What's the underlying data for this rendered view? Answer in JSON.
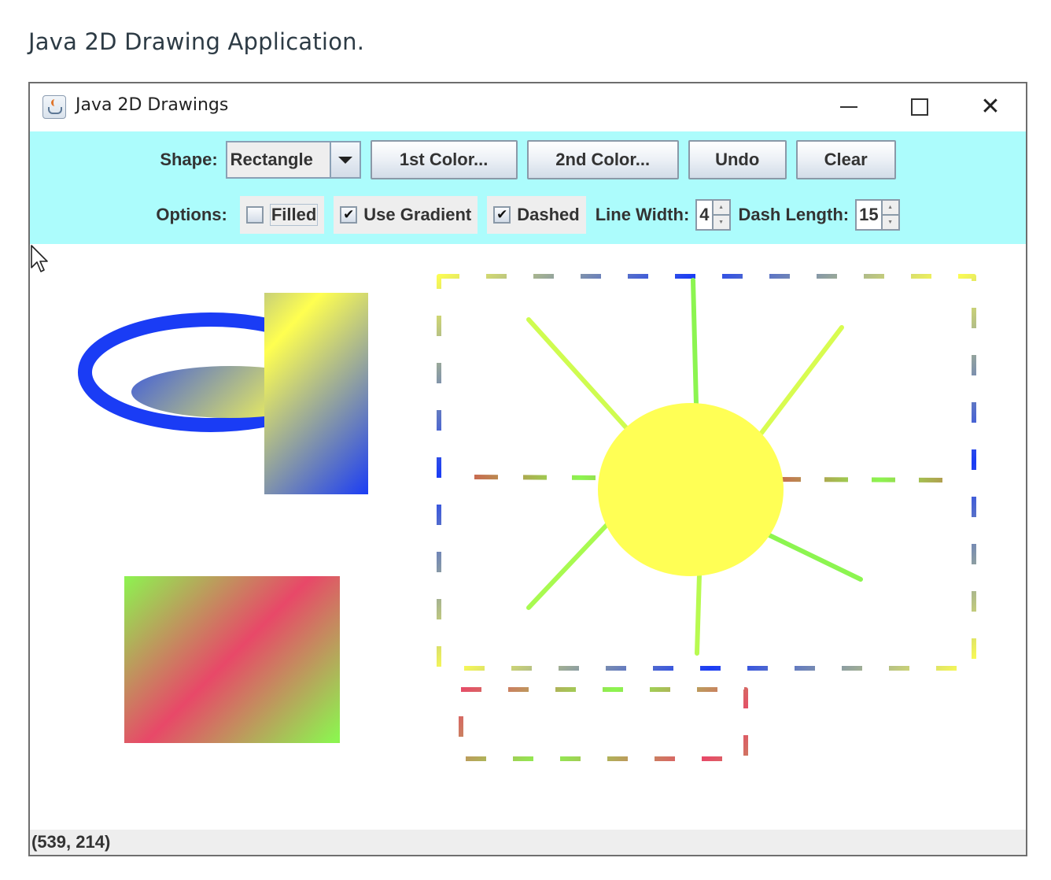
{
  "page": {
    "heading": "Java 2D Drawing Application."
  },
  "window": {
    "title": "Java 2D Drawings",
    "icon": "java-app-icon",
    "controls": {
      "minimize_icon": "minimize-icon",
      "maximize_icon": "maximize-icon",
      "close_glyph": "✕"
    }
  },
  "toolbar": {
    "shape_label": "Shape:",
    "shape_selected": "Rectangle",
    "first_color_label": "1st Color...",
    "second_color_label": "2nd Color...",
    "undo_label": "Undo",
    "clear_label": "Clear",
    "options_label": "Options:",
    "filled": {
      "label": "Filled",
      "checked": false,
      "mark": ""
    },
    "use_gradient": {
      "label": "Use Gradient",
      "checked": true,
      "mark": "✔"
    },
    "dashed": {
      "label": "Dashed",
      "checked": true,
      "mark": "✔"
    },
    "line_width_label": "Line Width:",
    "line_width_value": "4",
    "dash_length_label": "Dash Length:",
    "dash_length_value": "15",
    "spinner_up": "▲",
    "spinner_down": "▼"
  },
  "canvas": {
    "colors": {
      "blue": "#1a3cf5",
      "yellow": "#ffff50",
      "green": "#8cf550",
      "red": "#e84868",
      "sun": "#ffff55"
    },
    "shapes": [
      {
        "type": "oval-outline",
        "color": "blue",
        "dashed": false,
        "gradient": false
      },
      {
        "type": "oval-filled",
        "colors": [
          "blue",
          "yellow"
        ],
        "gradient": true
      },
      {
        "type": "rectangle-filled",
        "colors": [
          "blue",
          "yellow"
        ],
        "gradient": true
      },
      {
        "type": "rectangle-filled",
        "colors": [
          "green",
          "red"
        ],
        "gradient": true
      },
      {
        "type": "rectangle-dashed",
        "colors": [
          "yellow",
          "blue"
        ],
        "gradient": true
      },
      {
        "type": "oval-filled",
        "colors": [
          "sun"
        ],
        "gradient": false
      },
      {
        "type": "line-rays",
        "count": 8,
        "colors": [
          "yellow",
          "green"
        ]
      },
      {
        "type": "rectangle-dashed",
        "colors": [
          "red",
          "green"
        ],
        "gradient": true
      }
    ]
  },
  "status_bar": {
    "coordinates": "(539, 214)"
  }
}
